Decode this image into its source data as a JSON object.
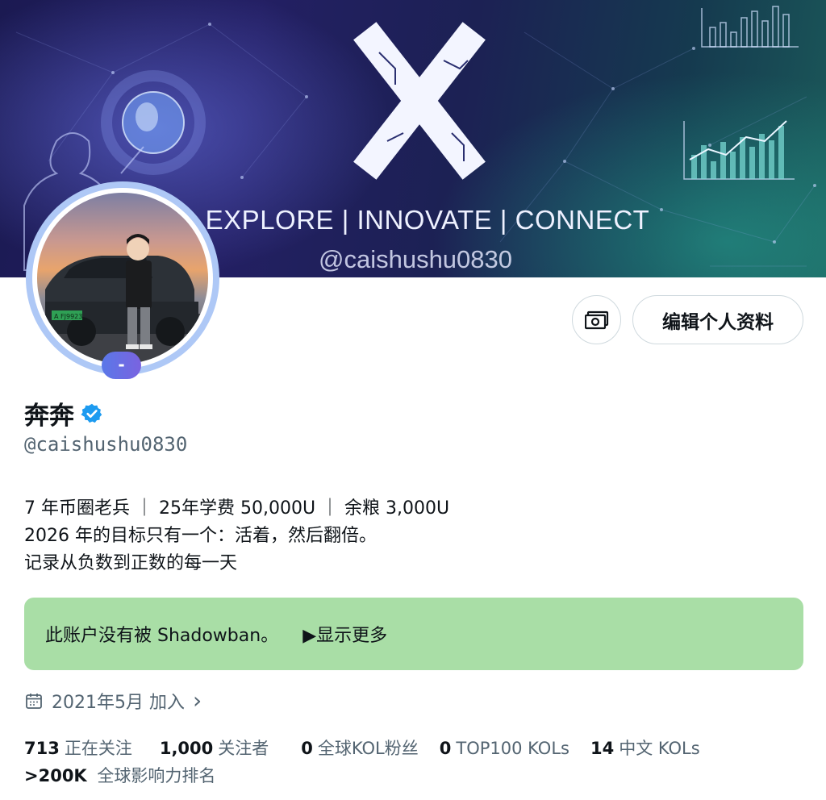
{
  "banner": {
    "tagline": "EXPLORE | INNOVATE | CONNECT",
    "handle": "@caishushu0830",
    "logo_icon": "x-logo-icon"
  },
  "avatar": {
    "badge_label": "-",
    "plate_text": "A FJ9923"
  },
  "actions": {
    "money_icon": "money-icon",
    "edit_label": "编辑个人资料"
  },
  "profile": {
    "display_name": "奔奔",
    "verified_icon": "verified-badge-icon",
    "handle": "@caishushu0830",
    "bio": [
      "7 年币圈老兵 ｜ 25年学费 50,000U ｜ 余粮 3,000U",
      "2026 年的目标只有一个：活着，然后翻倍。",
      "记录从负数到正数的每一天"
    ]
  },
  "shadowban": {
    "text": "此账户没有被 Shadowban。",
    "more_label": "▶显示更多"
  },
  "joined": {
    "text": "2021年5月 加入",
    "chevron": "›"
  },
  "stats": {
    "following_count": "713",
    "following_label": "正在关注",
    "followers_count": "1,000",
    "followers_label": "关注者",
    "global_kol_count": "0",
    "global_kol_label": "全球KOL粉丝",
    "top100_count": "0",
    "top100_label": "TOP100 KOLs",
    "cn_kol_count": "14",
    "cn_kol_label": "中文 KOLs",
    "rank_value": ">200K",
    "rank_label": "全球影响力排名"
  },
  "colors": {
    "accent": "#1d9bf0",
    "shadowban_bg": "#a9dea6",
    "secondary_text": "#536471"
  }
}
